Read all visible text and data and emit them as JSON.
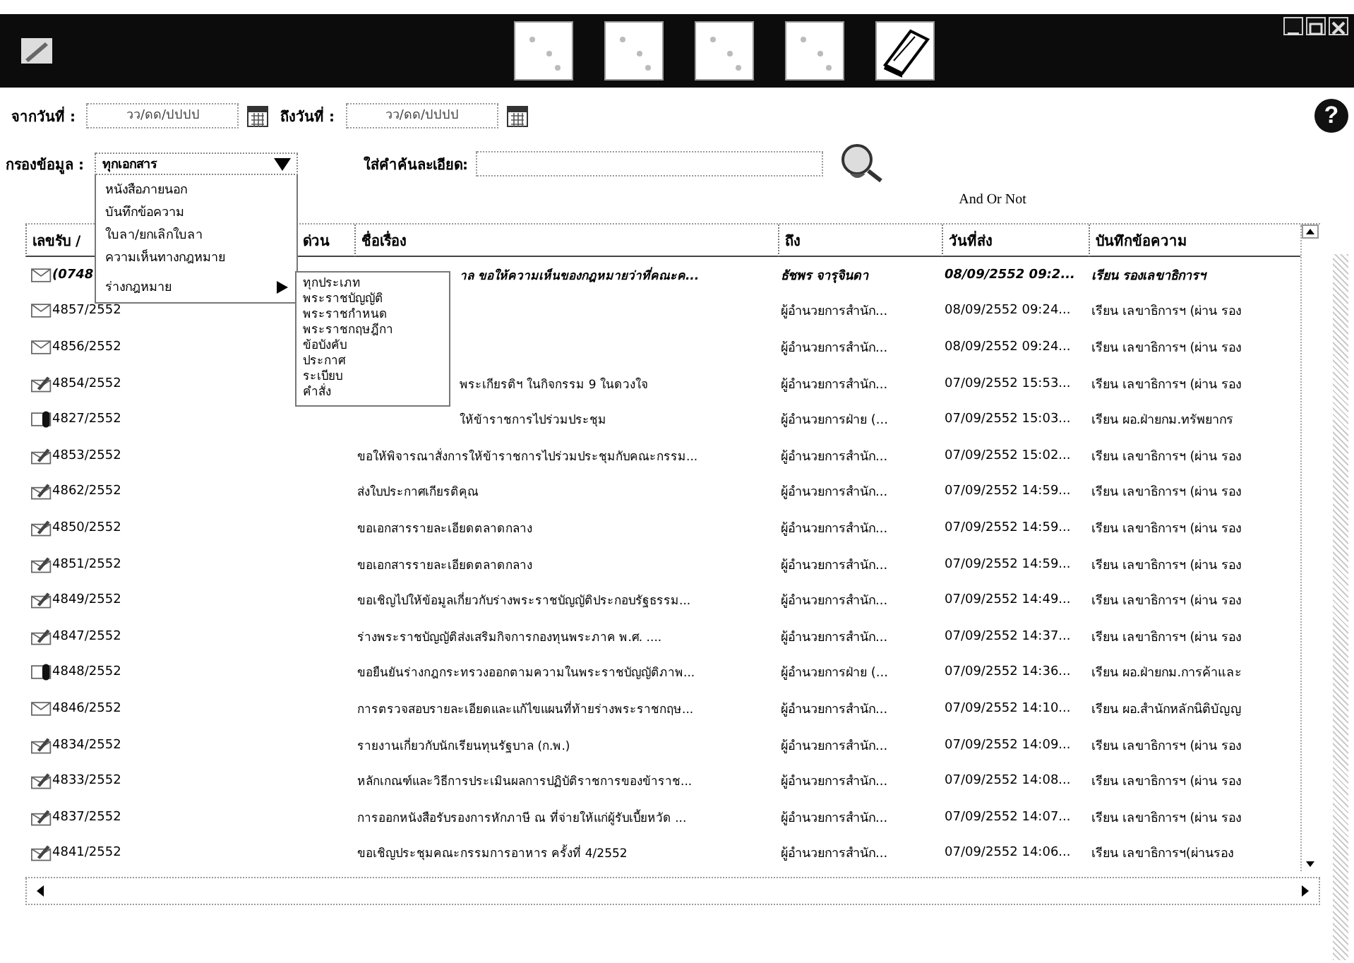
{
  "toolbar": {
    "buttons": [
      {
        "kind": "blank"
      },
      {
        "kind": "blank"
      },
      {
        "kind": "blank"
      },
      {
        "kind": "blank"
      },
      {
        "kind": "book"
      }
    ]
  },
  "date_from": {
    "label": "จากวันที่ :",
    "placeholder": "วว/ดด/ปปปป"
  },
  "date_to": {
    "label": "ถึงวันที่ :",
    "placeholder": "วว/ดด/ปปปป"
  },
  "help": "?",
  "filter": {
    "label": "กรองข้อมูล :",
    "value": "ทุกเอกสาร",
    "expanded": true,
    "options": [
      {
        "label": "หนังสือภายนอก"
      },
      {
        "label": "บันทึกข้อความ"
      },
      {
        "label": "ใบลา/ยกเลิกใบลา"
      },
      {
        "label": "ความเห็นทางกฎหมาย"
      },
      {
        "label": "ร่างกฎหมาย",
        "expanded": true,
        "children": [
          "ทุกประเภท",
          "พระราชบัญญัติ",
          "พระราชกำหนด",
          "พระราชกฤษฎีกา",
          "ข้อบังคับ",
          "ประกาศ",
          "ระเบียบ",
          "คำสั่ง"
        ]
      }
    ]
  },
  "search": {
    "label": "ใส่คำค้นละเอียด:",
    "hint": "And Or Not"
  },
  "table": {
    "columns": [
      "เลขรับ /",
      "ด่วน",
      "ชื่อเรื่อง",
      "ถึง",
      "วันที่ส่ง",
      "บันทึกข้อความ"
    ],
    "rows": [
      {
        "kind": "envelope",
        "unread": true,
        "number": "(0748",
        "subject": "าล ขอให้ความเห็นของกฎหมายว่าที่คณะค...",
        "to": "ธัชพร จารุจินดา",
        "date": "08/09/2552  09:2...",
        "note": "เรียน รองเลขาธิการฯ"
      },
      {
        "kind": "envelope",
        "unread": false,
        "number": "4857/2552",
        "to": "ผู้อำนวยการสำนัก...",
        "date": "08/09/2552  09:24...",
        "note": "เรียน เลขาธิการฯ (ผ่าน รอง"
      },
      {
        "kind": "envelope",
        "unread": false,
        "number": "4856/2552",
        "to": "ผู้อำนวยการสำนัก...",
        "date": "08/09/2552  09:24...",
        "note": "เรียน เลขาธิการฯ (ผ่าน รอง"
      },
      {
        "kind": "signed",
        "unread": false,
        "number": "4854/2552",
        "subject": "พระเกียรติฯ ในกิจกรรม 9 ในดวงใจ",
        "to": "ผู้อำนวยการสำนัก...",
        "date": "07/09/2552  15:53...",
        "note": "เรียน เลขาธิการฯ (ผ่าน รอง"
      },
      {
        "kind": "clipped",
        "unread": false,
        "number": "4827/2552",
        "subject": "ให้ข้าราชการไปร่วมประชุม",
        "to": "ผู้อำนวยการฝ่าย (...",
        "date": "07/09/2552  15:03...",
        "note": "เรียน ผอ.ฝ่ายกม.ทรัพยากร"
      },
      {
        "kind": "signed",
        "unread": false,
        "number": "4853/2552",
        "subject": "ขอให้พิจารณาสั่งการให้ข้าราชการไปร่วมประชุมกับคณะกรรม...",
        "to": "ผู้อำนวยการสำนัก...",
        "date": "07/09/2552  15:02...",
        "note": "เรียน เลขาธิการฯ (ผ่าน รอง"
      },
      {
        "kind": "signed",
        "unread": false,
        "number": "4862/2552",
        "subject": "ส่งใบประกาศเกียรติคุณ",
        "to": "ผู้อำนวยการสำนัก...",
        "date": "07/09/2552  14:59...",
        "note": "เรียน เลขาธิการฯ (ผ่าน รอง"
      },
      {
        "kind": "signed",
        "unread": false,
        "number": "4850/2552",
        "subject": "ขอเอกสารรายละเอียดตลาดกลาง",
        "to": "ผู้อำนวยการสำนัก...",
        "date": "07/09/2552  14:59...",
        "note": "เรียน เลขาธิการฯ (ผ่าน รอง"
      },
      {
        "kind": "signed",
        "unread": false,
        "number": "4851/2552",
        "subject": "ขอเอกสารรายละเอียดตลาดกลาง",
        "to": "ผู้อำนวยการสำนัก...",
        "date": "07/09/2552  14:59...",
        "note": "เรียน เลขาธิการฯ (ผ่าน รอง"
      },
      {
        "kind": "signed",
        "unread": false,
        "number": "4849/2552",
        "subject": "ขอเชิญไปให้ข้อมูลเกี่ยวกับร่างพระราชบัญญัติประกอบรัฐธรรม...",
        "to": "ผู้อำนวยการสำนัก...",
        "date": "07/09/2552  14:49...",
        "note": "เรียน เลขาธิการฯ (ผ่าน รอง"
      },
      {
        "kind": "signed",
        "unread": false,
        "number": "4847/2552",
        "subject": "ร่างพระราชบัญญัติส่งเสริมกิจการกองทุนพระภาค พ.ศ. ....",
        "to": "ผู้อำนวยการสำนัก...",
        "date": "07/09/2552  14:37...",
        "note": "เรียน เลขาธิการฯ (ผ่าน รอง"
      },
      {
        "kind": "clipped",
        "unread": false,
        "number": "4848/2552",
        "subject": "ขอยืนยันร่างกฎกระทรวงออกตามความในพระราชบัญญัติภาพ...",
        "to": "ผู้อำนวยการฝ่าย (...",
        "date": "07/09/2552  14:36...",
        "note": "เรียน ผอ.ฝ่ายกม.การค้าและ"
      },
      {
        "kind": "envelope",
        "unread": false,
        "number": "4846/2552",
        "subject": "การตรวจสอบรายละเอียดและแก้ไขแผนที่ท้ายร่างพระราชกฤษ...",
        "to": "ผู้อำนวยการสำนัก...",
        "date": "07/09/2552  14:10...",
        "note": "เรียน ผอ.สำนักหลักนิติบัญญ"
      },
      {
        "kind": "signed",
        "unread": false,
        "number": "4834/2552",
        "subject": "รายงานเกี่ยวกับนักเรียนทุนรัฐบาล (ก.พ.)",
        "to": "ผู้อำนวยการสำนัก...",
        "date": "07/09/2552  14:09...",
        "note": "เรียน เลขาธิการฯ (ผ่าน รอง"
      },
      {
        "kind": "signed",
        "unread": false,
        "number": "4833/2552",
        "subject": "หลักเกณฑ์และวิธีการประเมินผลการปฏิบัติราชการของข้าราช...",
        "to": "ผู้อำนวยการสำนัก...",
        "date": "07/09/2552  14:08...",
        "note": "เรียน เลขาธิการฯ (ผ่าน รอง"
      },
      {
        "kind": "signed",
        "unread": false,
        "number": "4837/2552",
        "subject": "การออกหนังสือรับรองการหักภาษี ณ ที่จ่ายให้แก่ผู้รับเบี้ยหวัด ...",
        "to": "ผู้อำนวยการสำนัก...",
        "date": "07/09/2552  14:07...",
        "note": "เรียน เลขาธิการฯ (ผ่าน รอง"
      },
      {
        "kind": "signed",
        "unread": false,
        "number": "4841/2552",
        "subject": "ขอเชิญประชุมคณะกรรมการอาหาร ครั้งที่ 4/2552",
        "to": "ผู้อำนวยการสำนัก...",
        "date": "07/09/2552  14:06...",
        "note": "เรียน เลขาธิการฯ(ผ่านรอง"
      }
    ]
  }
}
